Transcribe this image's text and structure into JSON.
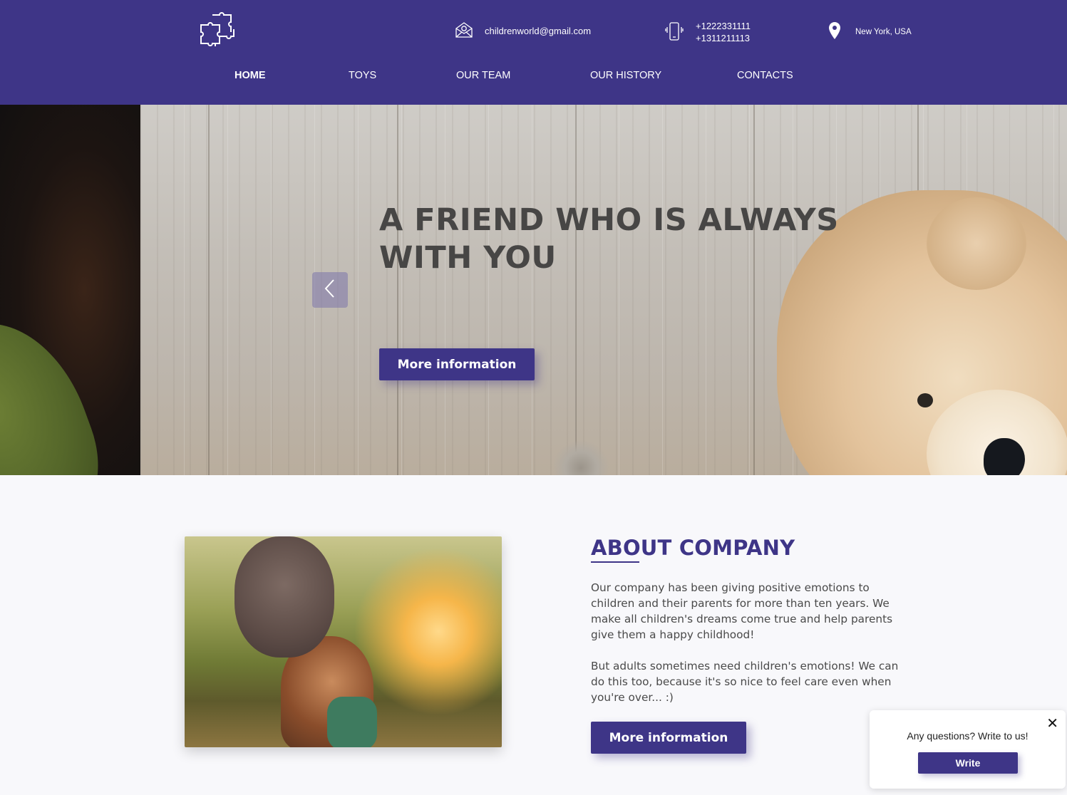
{
  "header": {
    "logo_icon": "puzzle-icon",
    "email": "childrenworld@gmail.com",
    "phone_1": "+1222331111",
    "phone_2": "+1311211113",
    "location": "New York, USA",
    "colors": {
      "brand": "#3e3587",
      "text": "#ffffff"
    }
  },
  "nav": {
    "items": [
      {
        "label": "HOME",
        "active": true
      },
      {
        "label": "TOYS"
      },
      {
        "label": "OUR TEAM"
      },
      {
        "label": "OUR HISTORY"
      },
      {
        "label": "CONTACTS"
      }
    ]
  },
  "hero": {
    "title": "A FRIEND WHO IS ALWAYS WITH YOU",
    "button_label": "More information",
    "prev_icon": "chevron-left-icon"
  },
  "about": {
    "title": "ABOUT COMPANY",
    "paragraph_1": "Our company has been giving positive emotions to children and their parents for more than ten years. We make all children's dreams come true and help parents give them a happy childhood!",
    "paragraph_2": "But adults sometimes need children's emotions! We can do this too, because it's so nice to feel care even when you're over... :)",
    "button_label": "More information"
  },
  "chat": {
    "text": "Any questions? Write to us!",
    "button_label": "Write",
    "close_glyph": "✕"
  }
}
